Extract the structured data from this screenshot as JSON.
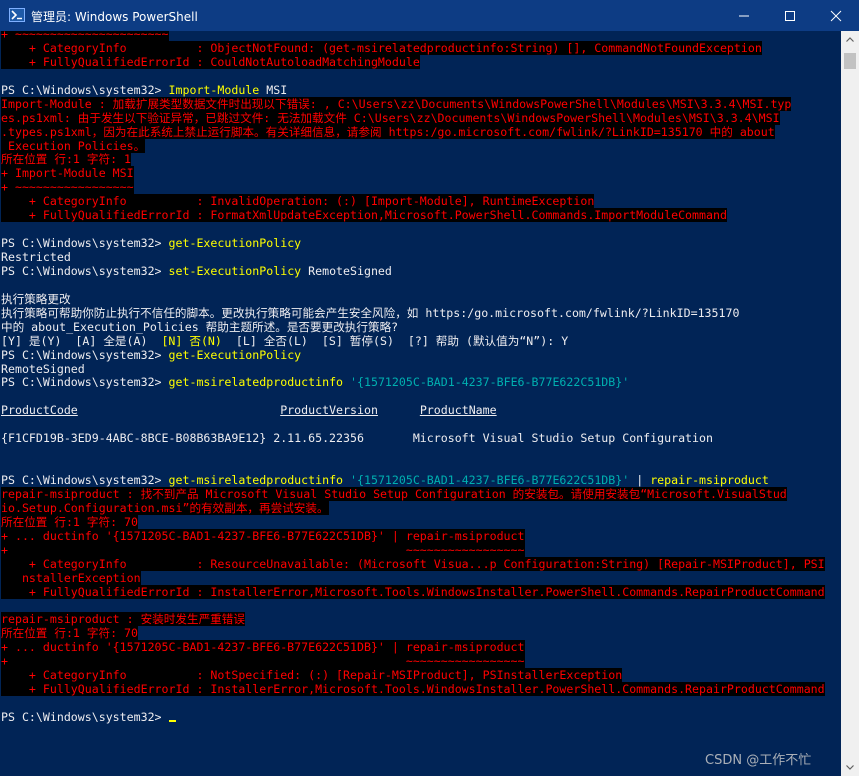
{
  "window": {
    "title": "管理员: Windows PowerShell",
    "icons": {
      "app": "powershell-icon",
      "minimize": "minimize-icon",
      "maximize": "maximize-icon",
      "close": "close-icon"
    },
    "colors": {
      "console_background": "#012456",
      "titlebar": "#0d3c84",
      "error_text": "#ff0000",
      "error_background": "#000000",
      "command": "#ffff00",
      "string": "#00b0b0",
      "output": "#eeedf0"
    }
  },
  "console": {
    "lines": [
      [
        {
          "t": "+ ~~~~~~~~~~~~~~~~~~~~~~",
          "s": "err"
        }
      ],
      [
        {
          "t": "    + CategoryInfo          : ObjectNotFound: (get-msirelatedproductinfo:String) [], CommandNotFoundException",
          "s": "err"
        }
      ],
      [
        {
          "t": "    + FullyQualifiedErrorId : CouldNotAutoloadMatchingModule",
          "s": "err"
        }
      ],
      [],
      [
        {
          "t": "PS C:\\Windows\\system32> ",
          "s": "prompt"
        },
        {
          "t": "Import-Module",
          "s": "cmd"
        },
        {
          "t": " MSI",
          "s": "arg"
        }
      ],
      [
        {
          "t": "Import-Module : 加载扩展类型数据文件时出现以下错误: , C:\\Users\\zz\\Documents\\WindowsPowerShell\\Modules\\MSI\\3.3.4\\MSI.typ",
          "s": "err"
        }
      ],
      [
        {
          "t": "es.ps1xml: 由于发生以下验证异常，已跳过文件: 无法加载文件 C:\\Users\\zz\\Documents\\WindowsPowerShell\\Modules\\MSI\\3.3.4\\MSI",
          "s": "err"
        }
      ],
      [
        {
          "t": ".types.ps1xml，因为在此系统上禁止运行脚本。有关详细信息，请参阅 https:/go.microsoft.com/fwlink/?LinkID=135170 中的 about",
          "s": "err"
        }
      ],
      [
        {
          "t": "_Execution_Policies。",
          "s": "err"
        }
      ],
      [
        {
          "t": "所在位置 行:1 字符: 1",
          "s": "err"
        }
      ],
      [
        {
          "t": "+ Import-Module MSI",
          "s": "err"
        }
      ],
      [
        {
          "t": "+ ~~~~~~~~~~~~~~~~~",
          "s": "err"
        }
      ],
      [
        {
          "t": "    + CategoryInfo          : InvalidOperation: (:) [Import-Module], RuntimeException",
          "s": "err"
        }
      ],
      [
        {
          "t": "    + FullyQualifiedErrorId : FormatXmlUpdateException,Microsoft.PowerShell.Commands.ImportModuleCommand",
          "s": "err"
        }
      ],
      [],
      [
        {
          "t": "PS C:\\Windows\\system32> ",
          "s": "prompt"
        },
        {
          "t": "get-ExecutionPolicy",
          "s": "cmd"
        }
      ],
      [
        {
          "t": "Restricted",
          "s": "out"
        }
      ],
      [
        {
          "t": "PS C:\\Windows\\system32> ",
          "s": "prompt"
        },
        {
          "t": "set-ExecutionPolicy",
          "s": "cmd"
        },
        {
          "t": " RemoteSigned",
          "s": "arg"
        }
      ],
      [],
      [
        {
          "t": "执行策略更改",
          "s": "out"
        }
      ],
      [
        {
          "t": "执行策略可帮助你防止执行不信任的脚本。更改执行策略可能会产生安全风险，如 https:/go.microsoft.com/fwlink/?LinkID=135170",
          "s": "out"
        }
      ],
      [
        {
          "t": "中的 about_Execution_Policies 帮助主题所述。是否要更改执行策略?",
          "s": "out"
        }
      ],
      [
        {
          "t": "[Y] 是(Y)  [A] 全是(A)  ",
          "s": "out"
        },
        {
          "t": "[N] 否(N)",
          "s": "cmd"
        },
        {
          "t": "  [L] 全否(L)  [S] 暂停(S)  [?] 帮助 (默认值为“N”): Y",
          "s": "out"
        }
      ],
      [
        {
          "t": "PS C:\\Windows\\system32> ",
          "s": "prompt"
        },
        {
          "t": "get-ExecutionPolicy",
          "s": "cmd"
        }
      ],
      [
        {
          "t": "RemoteSigned",
          "s": "out"
        }
      ],
      [
        {
          "t": "PS C:\\Windows\\system32> ",
          "s": "prompt"
        },
        {
          "t": "get-msirelatedproductinfo",
          "s": "cmd"
        },
        {
          "t": " '{1571205C-BAD1-4237-BFE6-B77E622C51DB}'",
          "s": "str"
        }
      ],
      [],
      [
        {
          "t": "ProductCode",
          "s": "out und"
        },
        {
          "t": "                             ",
          "s": "out"
        },
        {
          "t": "ProductVersion",
          "s": "out und"
        },
        {
          "t": "      ",
          "s": "out"
        },
        {
          "t": "ProductName",
          "s": "out und"
        }
      ],
      [],
      [
        {
          "t": "{F1CFD19B-3ED9-4ABC-8BCE-B08B63BA9E12} 2.11.65.22356       Microsoft Visual Studio Setup Configuration",
          "s": "out"
        }
      ],
      [],
      [],
      [
        {
          "t": "PS C:\\Windows\\system32> ",
          "s": "prompt"
        },
        {
          "t": "get-msirelatedproductinfo",
          "s": "cmd"
        },
        {
          "t": " '{1571205C-BAD1-4237-BFE6-B77E622C51DB}'",
          "s": "str"
        },
        {
          "t": " | ",
          "s": "arg"
        },
        {
          "t": "repair-msiproduct",
          "s": "cmd"
        }
      ],
      [
        {
          "t": "repair-msiproduct : 找不到产品 Microsoft Visual Studio Setup Configuration 的安装包。请使用安装包“Microsoft.VisualStud",
          "s": "err"
        }
      ],
      [
        {
          "t": "io.Setup.Configuration.msi”的有效副本，再尝试安装。",
          "s": "err"
        }
      ],
      [
        {
          "t": "所在位置 行:1 字符: 70",
          "s": "err"
        }
      ],
      [
        {
          "t": "+ ... ductinfo '{1571205C-BAD1-4237-BFE6-B77E622C51DB}' | repair-msiproduct",
          "s": "err"
        }
      ],
      [
        {
          "t": "+                                                         ~~~~~~~~~~~~~~~~~",
          "s": "err"
        }
      ],
      [
        {
          "t": "    + CategoryInfo          : ResourceUnavailable: (Microsoft Visua...p Configuration:String) [Repair-MSIProduct], PSI",
          "s": "err"
        }
      ],
      [
        {
          "t": "   nstallerException",
          "s": "err"
        }
      ],
      [
        {
          "t": "    + FullyQualifiedErrorId : InstallerError,Microsoft.Tools.WindowsInstaller.PowerShell.Commands.RepairProductCommand",
          "s": "err"
        }
      ],
      [],
      [
        {
          "t": "repair-msiproduct : 安装时发生严重错误",
          "s": "err"
        }
      ],
      [
        {
          "t": "所在位置 行:1 字符: 70",
          "s": "err"
        }
      ],
      [
        {
          "t": "+ ... ductinfo '{1571205C-BAD1-4237-BFE6-B77E622C51DB}' | repair-msiproduct",
          "s": "err"
        }
      ],
      [
        {
          "t": "+                                                         ~~~~~~~~~~~~~~~~~",
          "s": "err"
        }
      ],
      [
        {
          "t": "    + CategoryInfo          : NotSpecified: (:) [Repair-MSIProduct], PSInstallerException",
          "s": "err"
        }
      ],
      [
        {
          "t": "    + FullyQualifiedErrorId : InstallerError,Microsoft.Tools.WindowsInstaller.PowerShell.Commands.RepairProductCommand",
          "s": "err"
        }
      ],
      [],
      [
        {
          "t": "PS C:\\Windows\\system32> ",
          "s": "prompt"
        }
      ]
    ]
  },
  "scrollbar": {
    "up_icon": "scroll-up-arrow-icon",
    "down_icon": "scroll-down-arrow-icon"
  },
  "watermark": {
    "text": "CSDN @工作不忙"
  }
}
